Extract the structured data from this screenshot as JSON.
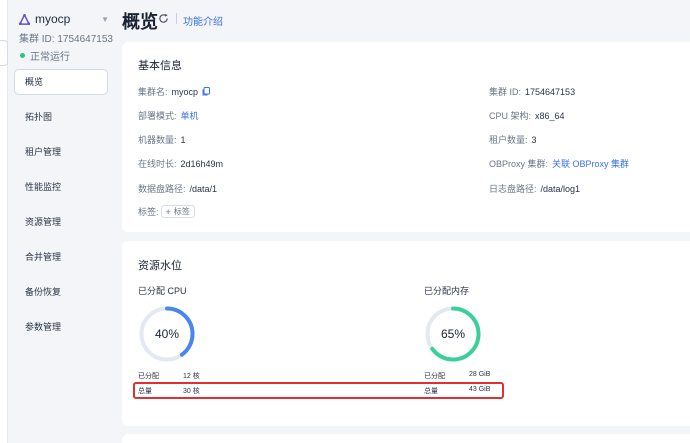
{
  "sidebar": {
    "cluster_name": "myocp",
    "cluster_id": "集群 ID: 1754647153",
    "status": "正常运行",
    "items": [
      {
        "label": "概览",
        "active": true
      },
      {
        "label": "拓扑图"
      },
      {
        "label": "租户管理"
      },
      {
        "label": "性能监控"
      },
      {
        "label": "资源管理"
      },
      {
        "label": "合并管理"
      },
      {
        "label": "备份恢复"
      },
      {
        "label": "参数管理"
      }
    ]
  },
  "header": {
    "title": "概览",
    "help_link": "功能介绍"
  },
  "basic_info": {
    "title": "基本信息",
    "cluster_name": {
      "k": "集群名:",
      "v": "myocp"
    },
    "cluster_id": {
      "k": "集群 ID:",
      "v": "1754647153"
    },
    "deploy_mode": {
      "k": "部署模式:",
      "v": "单机"
    },
    "cpu_arch": {
      "k": "CPU 架构:",
      "v": "x86_64"
    },
    "machine_count": {
      "k": "机器数量:",
      "v": "1"
    },
    "tenant_count": {
      "k": "租户数量:",
      "v": "3"
    },
    "uptime": {
      "k": "在线时长:",
      "v": "2d16h49m"
    },
    "obproxy": {
      "k": "OBProxy 集群:",
      "v": "关联 OBProxy 集群"
    },
    "data_path": {
      "k": "数据盘路径:",
      "v": "/data/1"
    },
    "log_path": {
      "k": "日志盘路径:",
      "v": "/data/log1"
    },
    "tags": {
      "k": "标签:",
      "button": "标签"
    }
  },
  "resource": {
    "title": "资源水位",
    "cpu": {
      "title": "已分配 CPU",
      "percent": 40,
      "percent_label": "40%",
      "color": "#4a86f0",
      "allocated_label": "已分配",
      "allocated_value": "12 核",
      "total_label": "总量",
      "total_value": "30 核"
    },
    "memory": {
      "title": "已分配内存",
      "percent": 65,
      "percent_label": "65%",
      "color": "#3ccf9a",
      "allocated_label": "已分配",
      "allocated_value": "28 GiB",
      "total_label": "总量",
      "total_value": "43 GiB"
    }
  }
}
